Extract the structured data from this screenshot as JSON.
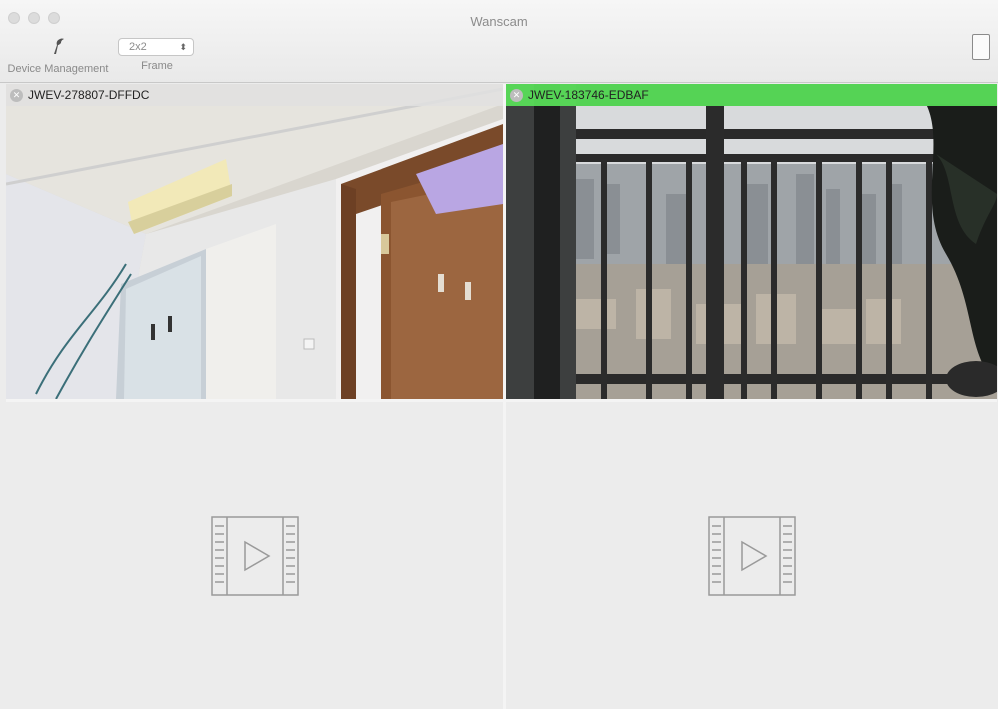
{
  "window": {
    "title": "Wanscam"
  },
  "toolbar": {
    "device_management_label": "Device Management",
    "frame_label": "Frame",
    "frame_value": "2x2",
    "device_management_icon": "fish-icon",
    "fullscreen_icon": "fullscreen-icon"
  },
  "cameras": [
    {
      "name": "JWEV-278807-DFFDC",
      "state": "live"
    },
    {
      "name": "JWEV-183746-EDBAF",
      "state": "live"
    },
    {
      "name": "",
      "state": "empty"
    },
    {
      "name": "",
      "state": "empty"
    }
  ],
  "colors": {
    "active_header": "#5ae65a",
    "placeholder": "#9a9a9a"
  }
}
